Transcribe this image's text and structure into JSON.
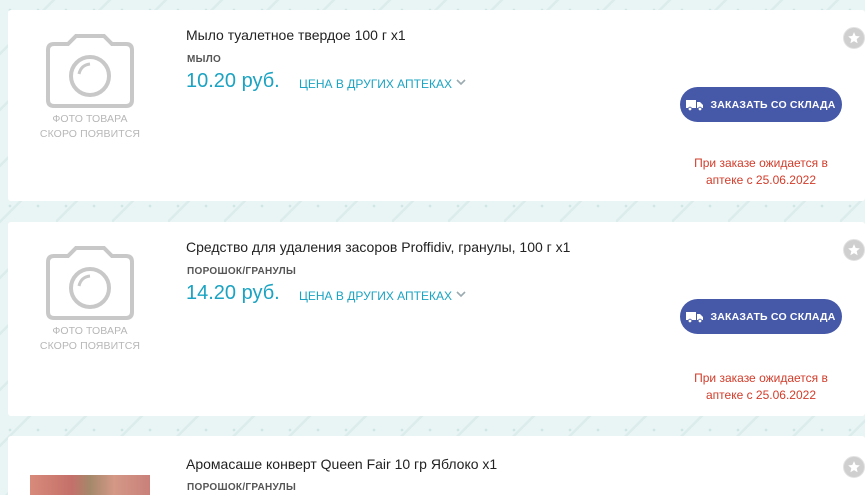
{
  "products": [
    {
      "title": "Мыло туалетное твердое 100 г x1",
      "category": "МЫЛО",
      "price": "10.20 руб.",
      "other_pharmacies": "ЦЕНА В ДРУГИХ АПТЕКАХ",
      "photo_caption_1": "ФОТО ТОВАРА",
      "photo_caption_2": "СКОРО ПОЯВИТСЯ",
      "order_button": "ЗАКАЗАТЬ СО СКЛАДА",
      "expected_line_1": "При заказе ожидается в",
      "expected_line_2": "аптеке с 25.06.2022"
    },
    {
      "title": "Средство для удаления засоров Proffidiv, гранулы, 100 г x1",
      "category": "ПОРОШОК/ГРАНУЛЫ",
      "price": "14.20 руб.",
      "other_pharmacies": "ЦЕНА В ДРУГИХ АПТЕКАХ",
      "photo_caption_1": "ФОТО ТОВАРА",
      "photo_caption_2": "СКОРО ПОЯВИТСЯ",
      "order_button": "ЗАКАЗАТЬ СО СКЛАДА",
      "expected_line_1": "При заказе ожидается в",
      "expected_line_2": "аптеке с 25.06.2022"
    },
    {
      "title": "Аромасаше конверт Queen Fair 10 гр Яблоко x1",
      "category": "ПОРОШОК/ГРАНУЛЫ"
    }
  ],
  "icons": {
    "placeholder": "camera-icon",
    "favorite": "star-icon",
    "order": "truck-icon",
    "expand": "chevron-down-icon"
  },
  "colors": {
    "price": "#1aa3c2",
    "button": "#4658a8",
    "expected": "#d23c2a",
    "background": "#e9f5f4"
  }
}
